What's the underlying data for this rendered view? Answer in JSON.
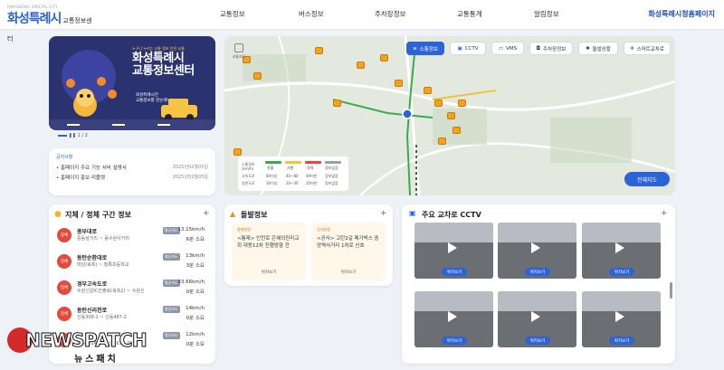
{
  "header": {
    "logo_small": "HWASEONG SPECIAL CITY",
    "logo_main": "화성특례시",
    "logo_sub": "교통정보센터",
    "menu": [
      "교통정보",
      "버스정보",
      "주차장정보",
      "교통통계",
      "알림정보"
    ],
    "home_link": "화성특례시청홈페이지"
  },
  "banner": {
    "tagline": "누구나 누리는 교통 정보 안전 교통",
    "title_line1": "화성특례시",
    "title_line2": "교통정보센터",
    "note_line1": "화성특례시만",
    "note_line2": "교통정보를 한눈에!",
    "pager": "1 / 2"
  },
  "notice": {
    "tag": "공지사항",
    "items": [
      {
        "title": "홈페이지 주요 기능 서비 설명서",
        "date": "2025년02월05일"
      },
      {
        "title": "홈페이지 홍보 리플렛",
        "date": "2025년02월05일"
      }
    ]
  },
  "map": {
    "side_label": "교통지도",
    "buttons": [
      "소통정보",
      "CCTV",
      "VMS",
      "주차장정보",
      "돌발상황",
      "스마트교차로"
    ],
    "full_view": "전체지도",
    "legend": {
      "row_head": "소통정보\n(km/h)",
      "cols": [
        "원활",
        "서행",
        "정체",
        "정보없음"
      ],
      "rows": [
        {
          "name": "고속도로",
          "vals": [
            "80이상",
            "40~80",
            "40미만",
            "정보없음"
          ]
        },
        {
          "name": "일반도로",
          "vals": [
            "30이상",
            "20~30",
            "20미만",
            "정보없음"
          ]
        }
      ],
      "colors": [
        "#3aaa4f",
        "#f0c43a",
        "#e34a3c",
        "#9aa0a8"
      ]
    }
  },
  "congestion": {
    "title": "지체 / 정체 구간 정보",
    "avg_label": "평균속도",
    "items": [
      {
        "badge": "정체",
        "name": "중부대로",
        "path": "중동삼거리 ~ 동수원사거리",
        "speed": "13.15km/h",
        "time": "6분 소요"
      },
      {
        "badge": "정체",
        "name": "동탄순환대로",
        "path": "태남(북측) ~ 청록초등학교",
        "speed": "13km/h",
        "time": "3분 소요"
      },
      {
        "badge": "정체",
        "name": "경부고속도로",
        "path": "수원신갈IC진출로(북측2) ~ 수원신",
        "speed": "33.66km/h",
        "time": "0분 소요"
      },
      {
        "badge": "정체",
        "name": "동탄신리천로",
        "path": "신동308-1 ~ 신동487-2",
        "speed": "14km/h",
        "time": "0분 소요"
      },
      {
        "badge": "정체",
        "name": "",
        "path": "산동1014-2 ~ 신동674-78",
        "speed": "12km/h",
        "time": "0분 소요"
      }
    ]
  },
  "accident": {
    "title": "돌발정보",
    "items": [
      {
        "badge": "통제발생",
        "text": "<통제> 인천로 은혜의진리교회 대동12차 진행방향 전",
        "link": "위치보기"
      },
      {
        "badge": "공사발생",
        "text": "<공사> 고탄2길 메가박스 중앙역사거리 1차로 신호",
        "link": "위치보기"
      }
    ]
  },
  "cctv": {
    "title": "주요 교차로 CCTV",
    "btn": "위치보기"
  },
  "watermark": {
    "brand": "NEWSPATCH",
    "korean": "뉴스패치"
  }
}
